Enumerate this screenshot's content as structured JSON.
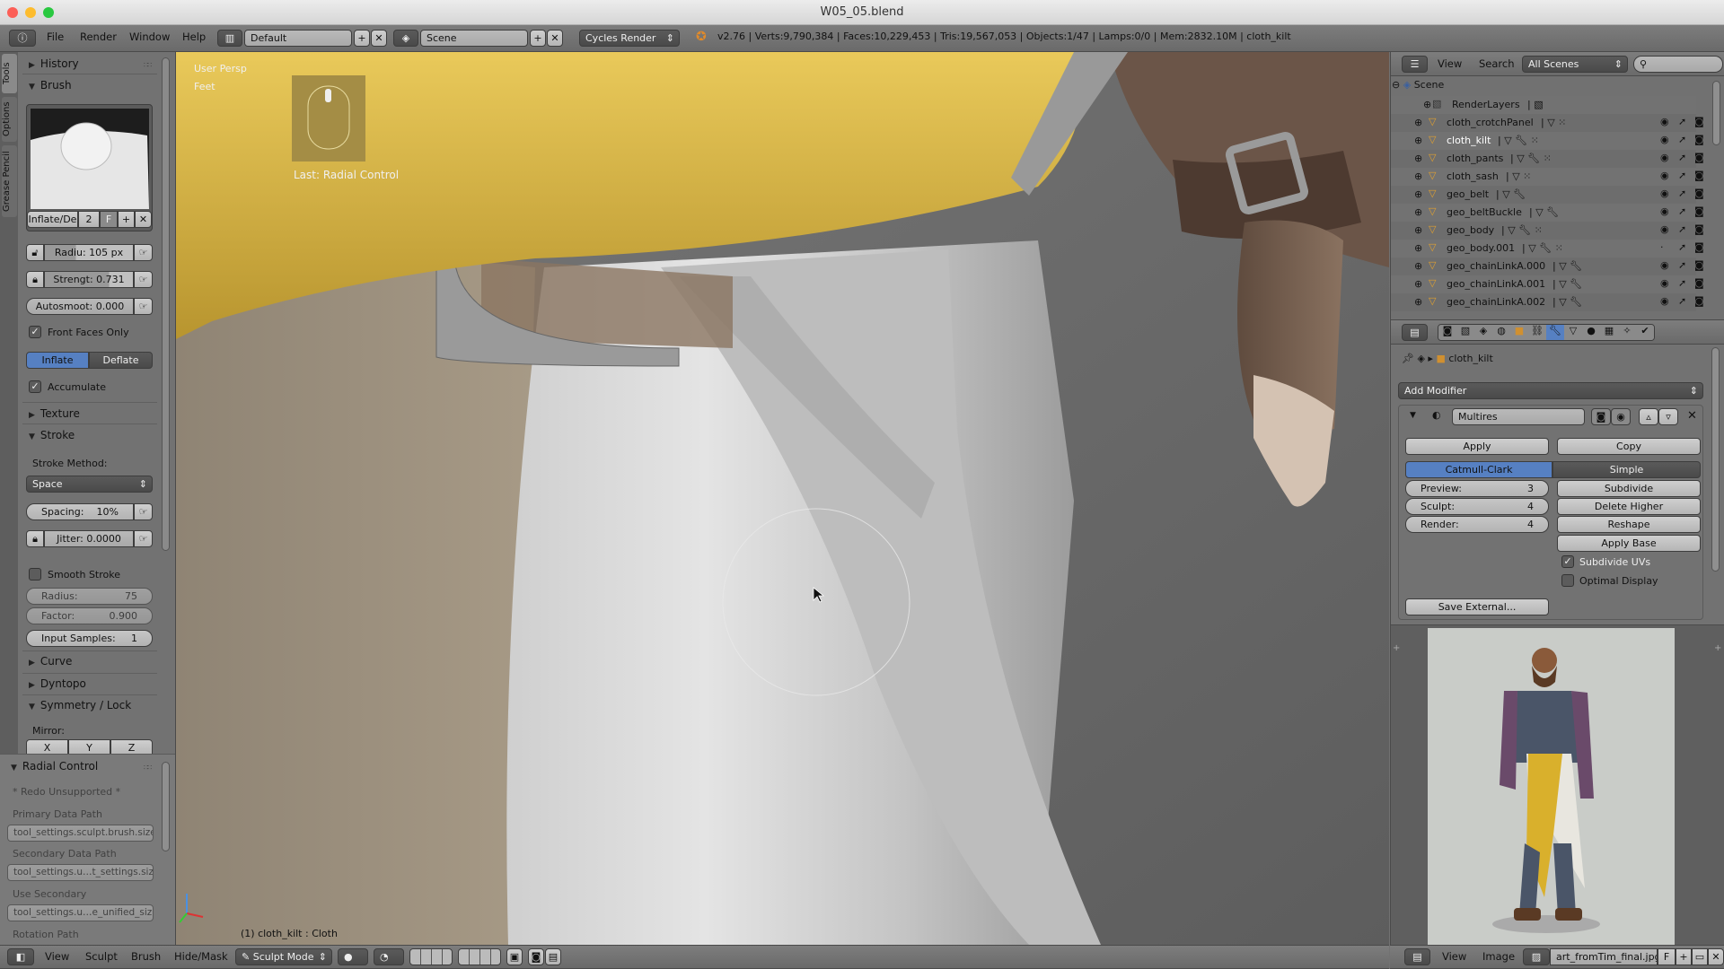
{
  "window": {
    "title": "W05_05.blend"
  },
  "info_header": {
    "menus": [
      "File",
      "Render",
      "Window",
      "Help"
    ],
    "layout": "Default",
    "scene": "Scene",
    "engine": "Cycles Render",
    "stats": "v2.76 | Verts:9,790,384 | Faces:10,229,453 | Tris:19,567,053 | Objects:1/47 | Lamps:0/0 | Mem:2832.10M | cloth_kilt"
  },
  "toolshelf": {
    "tabs": [
      "Tools",
      "Options",
      "Grease Pencil"
    ],
    "history": "History",
    "brush": "Brush",
    "brush_name": "Inflate/De",
    "brush_users": "2",
    "brush_fake": "F",
    "radius": "Radiu: 105 px",
    "strength": "Strengt: 0.731",
    "autosmooth": "Autosmoot: 0.000",
    "front_faces": "Front Faces Only",
    "front_faces_checked": true,
    "inflate": "Inflate",
    "deflate": "Deflate",
    "direction_active": "Inflate",
    "accumulate": "Accumulate",
    "accumulate_checked": true,
    "texture": "Texture",
    "stroke": "Stroke",
    "stroke_method_label": "Stroke Method:",
    "stroke_method": "Space",
    "spacing_label": "Spacing:",
    "spacing": "10%",
    "jitter": "Jitter: 0.0000",
    "smooth_stroke": "Smooth Stroke",
    "smooth_stroke_checked": false,
    "ss_radius_label": "Radius:",
    "ss_radius": "75",
    "ss_factor_label": "Factor:",
    "ss_factor": "0.900",
    "input_samples_label": "Input Samples:",
    "input_samples": "1",
    "curve": "Curve",
    "dyntopo": "Dyntopo",
    "symmetry": "Symmetry / Lock",
    "mirror": "Mirror:",
    "mirror_axes": [
      "X",
      "Y",
      "Z"
    ]
  },
  "redo_panel": {
    "title": "Radial Control",
    "redo": "* Redo Unsupported *",
    "primary_label": "Primary Data Path",
    "primary": "tool_settings.sculpt.brush.size",
    "secondary_label": "Secondary Data Path",
    "secondary": "tool_settings.u…t_settings.size",
    "use_secondary_label": "Use Secondary",
    "use_secondary": "tool_settings.u…e_unified_size",
    "rotation_label": "Rotation Path"
  },
  "viewport": {
    "view_name": "User Persp",
    "units": "Feet",
    "last_op": "Last: Radial Control",
    "object_info": "(1) cloth_kilt : Cloth",
    "brush_radius_px": 105
  },
  "viewport_header": {
    "menus": [
      "View",
      "Sculpt",
      "Brush",
      "Hide/Mask"
    ],
    "mode": "Sculpt Mode"
  },
  "outliner": {
    "menus": [
      "View",
      "Search"
    ],
    "filter": "All Scenes",
    "scene": "Scene",
    "items": [
      {
        "name": "RenderLayers",
        "type": "renderlayers"
      },
      {
        "name": "cloth_crotchPanel",
        "mod": false,
        "visible": true
      },
      {
        "name": "cloth_kilt",
        "mod": true,
        "active": true,
        "visible": true
      },
      {
        "name": "cloth_pants",
        "mod": true,
        "visible": true
      },
      {
        "name": "cloth_sash",
        "mod": false,
        "visible": true
      },
      {
        "name": "geo_belt",
        "mod": true,
        "visible": true
      },
      {
        "name": "geo_beltBuckle",
        "mod": true,
        "visible": true
      },
      {
        "name": "geo_body",
        "mod": true,
        "visible": true
      },
      {
        "name": "geo_body.001",
        "mod": true,
        "visible": false
      },
      {
        "name": "geo_chainLinkA.000",
        "mod": true,
        "visible": true
      },
      {
        "name": "geo_chainLinkA.001",
        "mod": true,
        "visible": true
      },
      {
        "name": "geo_chainLinkA.002",
        "mod": true,
        "visible": true
      }
    ]
  },
  "properties": {
    "object": "cloth_kilt",
    "add_modifier": "Add Modifier",
    "modifier_name": "Multires",
    "apply": "Apply",
    "copy": "Copy",
    "catmull": "Catmull-Clark",
    "simple": "Simple",
    "subdiv_active": "Catmull-Clark",
    "preview_label": "Preview:",
    "preview": "3",
    "sculpt_label": "Sculpt:",
    "sculpt": "4",
    "render_label": "Render:",
    "render": "4",
    "subdivide": "Subdivide",
    "delete_higher": "Delete Higher",
    "reshape": "Reshape",
    "apply_base": "Apply Base",
    "subdivide_uvs": "Subdivide UVs",
    "subdivide_uvs_checked": true,
    "optimal_display": "Optimal Display",
    "optimal_display_checked": false,
    "save_external": "Save External..."
  },
  "image_editor": {
    "menus": [
      "View",
      "Image"
    ],
    "image": "art_fromTim_final.jpg",
    "fake": "F"
  },
  "colors": {
    "accent": "#5680c2",
    "kilt_yellow": "#d8b84a",
    "viewport_bg": "#676767"
  }
}
